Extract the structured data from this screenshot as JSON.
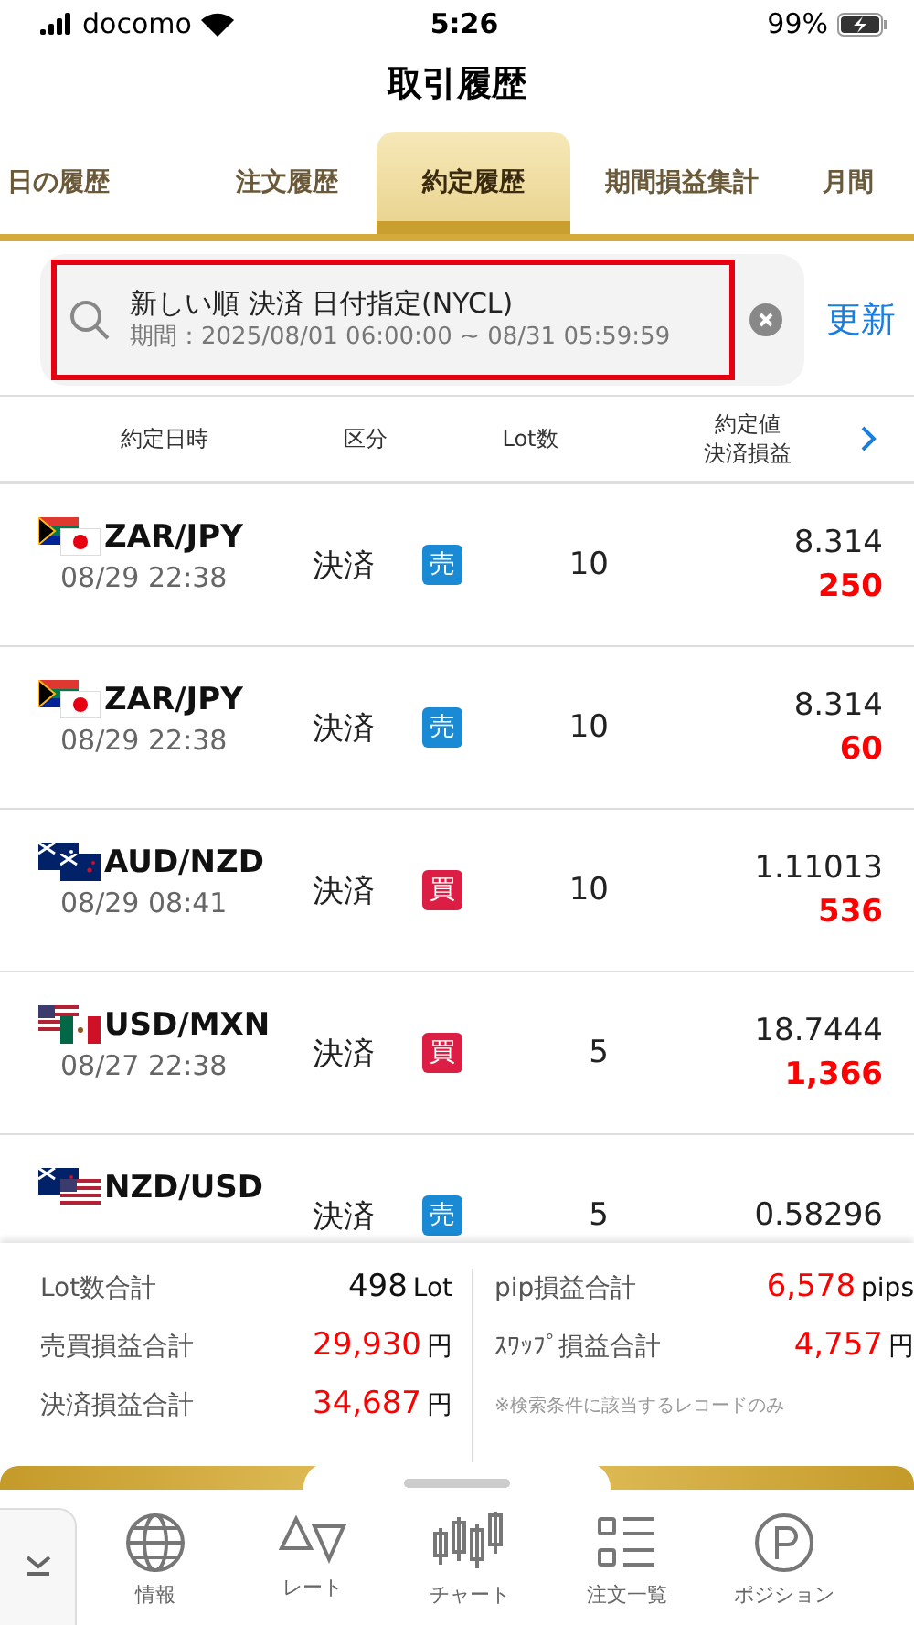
{
  "status_bar": {
    "carrier": "docomo",
    "time": "5:26",
    "battery": "99%"
  },
  "title": "取引履歴",
  "tabs": [
    {
      "label": "日の履歴",
      "selected": false
    },
    {
      "label": "注文履歴",
      "selected": false
    },
    {
      "label": "約定履歴",
      "selected": true
    },
    {
      "label": "期間損益集計",
      "selected": false
    },
    {
      "label": "月間",
      "selected": false
    }
  ],
  "search": {
    "conditions": "新しい順 決済 日付指定(NYCL)",
    "period": "期間：2025/08/01 06:00:00 ~ 08/31 05:59:59",
    "refresh": "更新"
  },
  "columns": [
    {
      "lines": [
        "約定日時"
      ]
    },
    {
      "lines": [
        "区分"
      ]
    },
    {
      "lines": [
        "Lot数"
      ]
    },
    {
      "lines": [
        "約定値",
        "決済損益"
      ]
    }
  ],
  "rows": [
    {
      "flags": [
        {
          "kind": "za"
        },
        {
          "kind": "jp"
        }
      ],
      "pair": "ZAR/JPY",
      "date": "08/29 22:38",
      "type": "決済",
      "side": {
        "kind": "sell",
        "label": "売"
      },
      "lots": "10",
      "price": "8.314",
      "pnl": "250"
    },
    {
      "flags": [
        {
          "kind": "za"
        },
        {
          "kind": "jp"
        }
      ],
      "pair": "ZAR/JPY",
      "date": "08/29 22:38",
      "type": "決済",
      "side": {
        "kind": "sell",
        "label": "売"
      },
      "lots": "10",
      "price": "8.314",
      "pnl": "60"
    },
    {
      "flags": [
        {
          "kind": "au"
        },
        {
          "kind": "nz"
        }
      ],
      "pair": "AUD/NZD",
      "date": "08/29 08:41",
      "type": "決済",
      "side": {
        "kind": "buy",
        "label": "買"
      },
      "lots": "10",
      "price": "1.11013",
      "pnl": "536"
    },
    {
      "flags": [
        {
          "kind": "us"
        },
        {
          "kind": "mx"
        }
      ],
      "pair": "USD/MXN",
      "date": "08/27 22:38",
      "type": "決済",
      "side": {
        "kind": "buy",
        "label": "買"
      },
      "lots": "5",
      "price": "18.7444",
      "pnl": "1,366"
    },
    {
      "flags": [
        {
          "kind": "nz"
        },
        {
          "kind": "us"
        }
      ],
      "pair": "NZD/USD",
      "type": "決済",
      "side": {
        "kind": "sell",
        "label": "売"
      },
      "lots": "5",
      "price": "0.58296"
    }
  ],
  "summary": {
    "left": [
      {
        "label": "Lot数合計",
        "value": "498",
        "unit": "Lot",
        "highlight": false
      },
      {
        "label": "売買損益合計",
        "value": "29,930",
        "unit": "円",
        "highlight": true
      },
      {
        "label": "決済損益合計",
        "value": "34,687",
        "unit": "円",
        "highlight": true
      }
    ],
    "right": [
      {
        "label": "pip損益合計",
        "value": "6,578",
        "unit": "pips",
        "highlight": true
      },
      {
        "label": "ｽﾜｯﾌﾟ損益合計",
        "value": "4,757",
        "unit": "円",
        "highlight": true
      }
    ],
    "note": "※検索条件に該当するレコードのみ"
  },
  "nav": [
    {
      "kind": "globe",
      "label": "情報"
    },
    {
      "kind": "rate",
      "label": "レート"
    },
    {
      "kind": "chart",
      "label": "チャート"
    },
    {
      "kind": "list",
      "label": "注文一覧"
    },
    {
      "kind": "position",
      "label": "ポジション"
    }
  ]
}
